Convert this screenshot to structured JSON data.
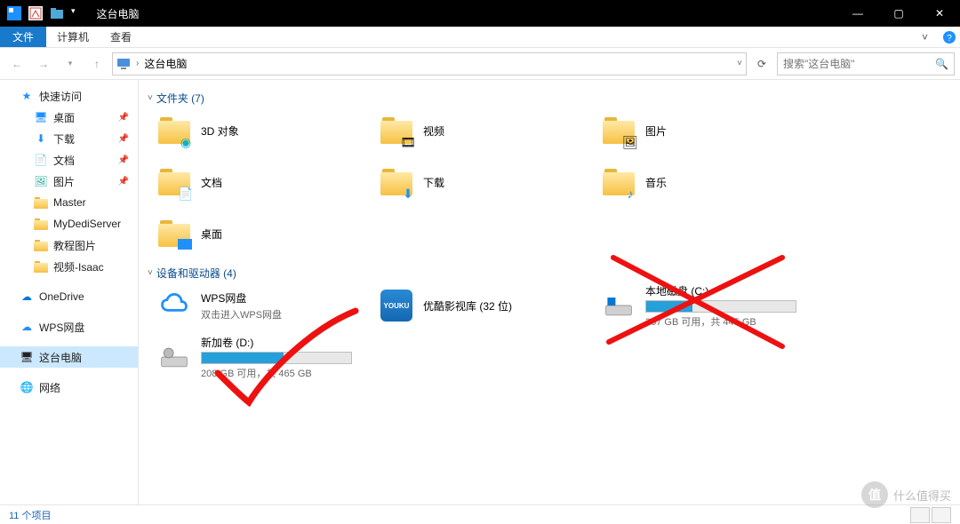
{
  "window": {
    "title": "这台电脑",
    "minimize": "—",
    "maximize": "▢",
    "close": "✕"
  },
  "menubar": {
    "file": "文件",
    "computer": "计算机",
    "view": "查看"
  },
  "address": {
    "path": "这台电脑",
    "search_placeholder": "搜索\"这台电脑\""
  },
  "sidebar": {
    "quick_access": "快速访问",
    "items": [
      {
        "label": "桌面",
        "pinned": true
      },
      {
        "label": "下载",
        "pinned": true
      },
      {
        "label": "文档",
        "pinned": true
      },
      {
        "label": "图片",
        "pinned": true
      },
      {
        "label": "Master",
        "pinned": false
      },
      {
        "label": "MyDediServer",
        "pinned": false
      },
      {
        "label": "教程图片",
        "pinned": false
      },
      {
        "label": "视频-Isaac",
        "pinned": false
      }
    ],
    "onedrive": "OneDrive",
    "wps": "WPS网盘",
    "thispc": "这台电脑",
    "network": "网络"
  },
  "groups": {
    "folders_header": "文件夹 (7)",
    "devices_header": "设备和驱动器 (4)"
  },
  "folders": [
    {
      "label": "3D 对象"
    },
    {
      "label": "视频"
    },
    {
      "label": "图片"
    },
    {
      "label": "文档"
    },
    {
      "label": "下载"
    },
    {
      "label": "音乐"
    },
    {
      "label": "桌面"
    }
  ],
  "devices": {
    "wps": {
      "label": "WPS网盘",
      "sub": "双击进入WPS网盘"
    },
    "youku": {
      "label": "优酷影视库 (32 位)"
    },
    "cdrive": {
      "label": "本地磁盘 (C:)",
      "sub": "307 GB 可用，共 445 GB",
      "used_pct": 31
    },
    "ddrive": {
      "label": "新加卷 (D:)",
      "sub": "208 GB 可用，共 465 GB",
      "used_pct": 55
    }
  },
  "status": {
    "items": "11 个项目"
  },
  "watermark": {
    "badge": "值",
    "text": "什么值得买"
  }
}
